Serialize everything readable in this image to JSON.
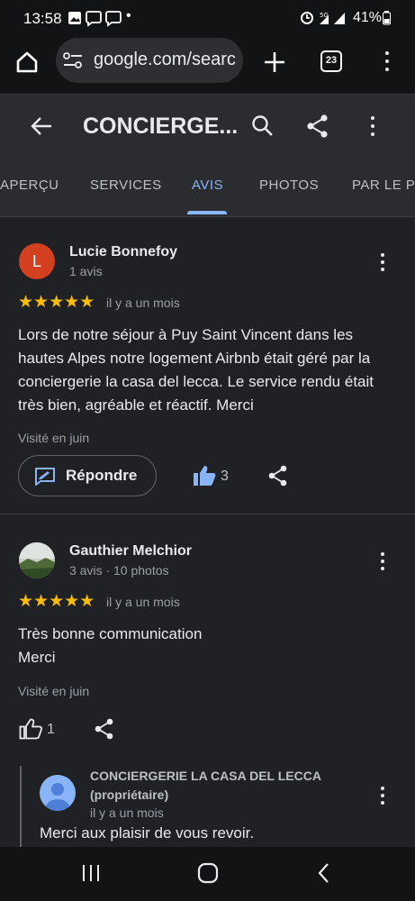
{
  "status_bar": {
    "time": "13:58",
    "battery": "41%",
    "dot": "•"
  },
  "browser": {
    "url": "google.com/searc",
    "tab_count": "23"
  },
  "app_bar": {
    "title": "CONCIERGE..."
  },
  "tabs": [
    {
      "label": "APERÇU"
    },
    {
      "label": "SERVICES"
    },
    {
      "label": "AVIS"
    },
    {
      "label": "PHOTOS"
    },
    {
      "label": "PAR LE PR"
    }
  ],
  "reviews": [
    {
      "avatar_letter": "L",
      "avatar_color": "#d2401f",
      "name": "Lucie Bonnefoy",
      "meta": "1 avis",
      "stars": "★★★★★",
      "date": "il y a un mois",
      "lines": [
        "Lors de notre séjour à Puy Saint Vincent dans les",
        "hautes Alpes notre logement Airbnb était géré par la",
        "conciergerie la casa del lecca. Le service rendu était",
        "très bien, agréable et réactif. Merci"
      ],
      "visited": "Visité en juin",
      "reply_label": "Répondre",
      "likes": "3"
    },
    {
      "name": "Gauthier Melchior",
      "meta": "3 avis · 10 photos",
      "stars": "★★★★★",
      "date": "il y a un mois",
      "lines": [
        "Très bonne communication",
        "Merci"
      ],
      "visited": "Visité en juin",
      "likes": "1"
    }
  ],
  "owner_reply": {
    "name_line1": "CONCIERGERIE LA CASA DEL LECCA",
    "name_line2": "(propriétaire)",
    "date": "il y a un mois",
    "text": "Merci aux plaisir de vous revoir."
  },
  "colors": {
    "accent": "#8ab4f8",
    "stars": "#fbbc04",
    "like_active": "#8ab4f8"
  }
}
